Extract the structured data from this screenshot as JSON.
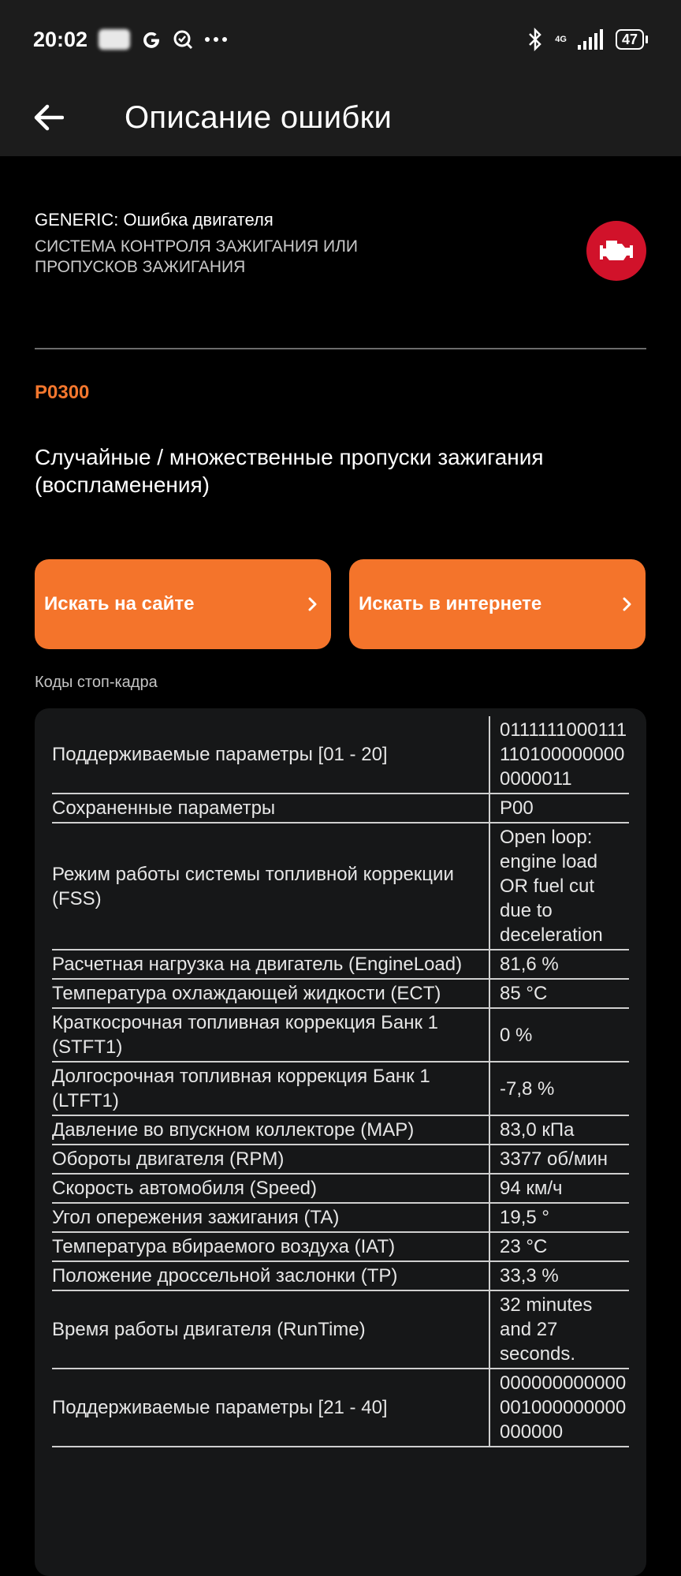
{
  "status_bar": {
    "time": "20:02",
    "battery": "47",
    "network": "4G"
  },
  "toolbar": {
    "title": "Описание ошибки"
  },
  "header": {
    "category": "GENERIC: Ошибка двигателя",
    "subsystem": "СИСТЕМА КОНТРОЛЯ ЗАЖИГАНИЯ ИЛИ ПРОПУСКОВ ЗАЖИГАНИЯ"
  },
  "code": "P0300",
  "description": "Случайные / множественные пропуски зажигания (воспламенения)",
  "buttons": {
    "search_site": "Искать на сайте",
    "search_web": "Искать в интернете"
  },
  "freeze_frame": {
    "title": "Коды стоп-кадра",
    "rows": [
      {
        "name": "Поддерживаемые параметры [01 - 20]",
        "value": "01111110001111101000000000000011"
      },
      {
        "name": "Сохраненные параметры",
        "value": "P00"
      },
      {
        "name": "Режим работы системы топливной коррекции (FSS)",
        "value": "Open loop: engine load OR fuel cut due to deceleration"
      },
      {
        "name": "Расчетная нагрузка на двигатель (EngineLoad)",
        "value": "81,6 %"
      },
      {
        "name": "Температура охлаждающей жидкости (ECT)",
        "value": "85 °C"
      },
      {
        "name": "Краткосрочная топливная коррекция Банк 1 (STFT1)",
        "value": "0 %"
      },
      {
        "name": "Долгосрочная топливная коррекция Банк 1 (LTFT1)",
        "value": "-7,8 %"
      },
      {
        "name": "Давление во впускном коллекторе (MAP)",
        "value": "83,0 кПа"
      },
      {
        "name": "Обороты двигателя (RPM)",
        "value": "3377 об/мин"
      },
      {
        "name": "Скорость автомобиля (Speed)",
        "value": "94 км/ч"
      },
      {
        "name": "Угол опережения зажигания (TA)",
        "value": "19,5 °"
      },
      {
        "name": "Температура вбираемого воздуха (IAT)",
        "value": "23 °C"
      },
      {
        "name": "Положение дроссельной заслонки (TP)",
        "value": "33,3 %"
      },
      {
        "name": "Время работы двигателя (RunTime)",
        "value": "32 minutes and 27 seconds."
      },
      {
        "name": "Поддерживаемые параметры [21 - 40]",
        "value": "000000000000001000000000000000"
      }
    ]
  }
}
